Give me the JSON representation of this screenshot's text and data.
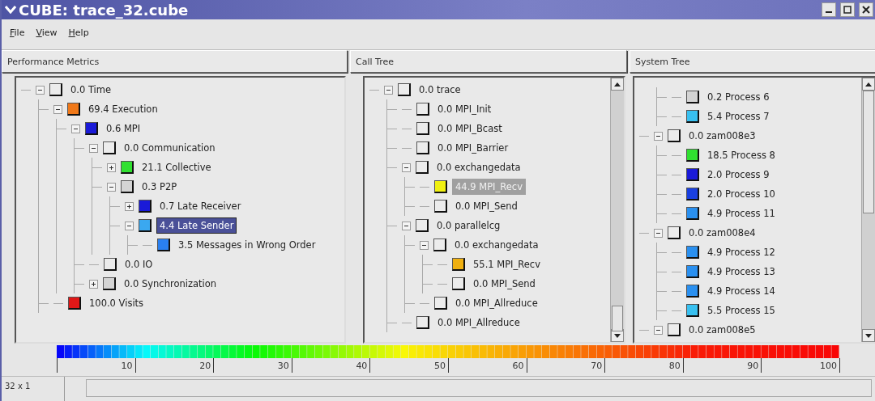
{
  "window": {
    "title": "CUBE: trace_32.cube"
  },
  "menu": [
    "File",
    "View",
    "Help"
  ],
  "metrics": {
    "title": "Performance Metrics",
    "items": [
      {
        "label": "0.0 Time",
        "color": "#ececec",
        "expanded": true,
        "selected": false,
        "children": [
          {
            "label": "69.4 Execution",
            "color": "#f07818",
            "expanded": true,
            "selected": false,
            "children": [
              {
                "label": "0.6 MPI",
                "color": "#1a1ad8",
                "expanded": true,
                "selected": false,
                "children": [
                  {
                    "label": "0.0 Communication",
                    "color": "#ececec",
                    "expanded": true,
                    "selected": false,
                    "children": [
                      {
                        "label": "21.1 Collective",
                        "color": "#30e030",
                        "expanded": false,
                        "selected": false
                      },
                      {
                        "label": "0.3 P2P",
                        "color": "#d4d4d4",
                        "expanded": true,
                        "selected": false,
                        "children": [
                          {
                            "label": "0.7 Late Receiver",
                            "color": "#1a1ad8",
                            "expanded": false,
                            "selected": false
                          },
                          {
                            "label": "4.4 Late Sender",
                            "color": "#3aa8f0",
                            "expanded": true,
                            "selected": true,
                            "children": [
                              {
                                "label": "3.5 Messages in Wrong Order",
                                "color": "#2a80f0",
                                "selected": false
                              }
                            ]
                          }
                        ]
                      }
                    ]
                  },
                  {
                    "label": "0.0 IO",
                    "color": "#ececec",
                    "selected": false
                  },
                  {
                    "label": "0.0 Synchronization",
                    "color": "#d4d4d4",
                    "expanded": false,
                    "selected": false
                  }
                ]
              }
            ]
          },
          {
            "label": "100.0 Visits",
            "color": "#e01818",
            "selected": false
          }
        ]
      }
    ]
  },
  "call_tree": {
    "title": "Call Tree",
    "items": [
      {
        "label": "0.0 trace",
        "color": "#ececec",
        "expanded": true,
        "selected": false,
        "children": [
          {
            "label": "0.0 MPI_Init",
            "color": "#ececec",
            "selected": false
          },
          {
            "label": "0.0 MPI_Bcast",
            "color": "#ececec",
            "selected": false
          },
          {
            "label": "0.0 MPI_Barrier",
            "color": "#ececec",
            "selected": false
          },
          {
            "label": "0.0 exchangedata",
            "color": "#ececec",
            "expanded": true,
            "selected": false,
            "children": [
              {
                "label": "44.9 MPI_Recv",
                "color": "#f0f010",
                "selected": true
              },
              {
                "label": "0.0 MPI_Send",
                "color": "#ececec",
                "selected": false
              }
            ]
          },
          {
            "label": "0.0 parallelcg",
            "color": "#ececec",
            "expanded": true,
            "selected": false,
            "children": [
              {
                "label": "0.0 exchangedata",
                "color": "#ececec",
                "expanded": true,
                "selected": false,
                "children": [
                  {
                    "label": "55.1 MPI_Recv",
                    "color": "#f0b010",
                    "selected": false
                  },
                  {
                    "label": "0.0 MPI_Send",
                    "color": "#ececec",
                    "selected": false
                  }
                ]
              },
              {
                "label": "0.0 MPI_Allreduce",
                "color": "#ececec",
                "selected": false
              }
            ]
          },
          {
            "label": "0.0 MPI_Allreduce",
            "color": "#ececec",
            "selected": false
          }
        ]
      }
    ]
  },
  "system_tree": {
    "title": "System Tree",
    "continued": [
      {
        "label": "0.2 Process 6",
        "color": "#d4d4d4",
        "selected": false
      },
      {
        "label": "5.4 Process 7",
        "color": "#38c0f0",
        "selected": false
      }
    ],
    "items": [
      {
        "label": "0.0 zam008e3",
        "color": "#ececec",
        "expanded": true,
        "selected": false,
        "children": [
          {
            "label": "18.5 Process 8",
            "color": "#30e030",
            "selected": false
          },
          {
            "label": "2.0 Process 9",
            "color": "#1a1ad8",
            "selected": false
          },
          {
            "label": "2.0 Process 10",
            "color": "#1a40e0",
            "selected": false
          },
          {
            "label": "4.9 Process 11",
            "color": "#2a90f0",
            "selected": false
          }
        ]
      },
      {
        "label": "0.0 zam008e4",
        "color": "#ececec",
        "expanded": true,
        "selected": false,
        "children": [
          {
            "label": "4.9 Process 12",
            "color": "#2a90f0",
            "selected": false
          },
          {
            "label": "4.9 Process 13",
            "color": "#2a90f0",
            "selected": false
          },
          {
            "label": "4.9 Process 14",
            "color": "#2a90f0",
            "selected": false
          },
          {
            "label": "5.5 Process 15",
            "color": "#38c0f0",
            "selected": false
          }
        ]
      },
      {
        "label": "0.0 zam008e5",
        "color": "#ececec",
        "expanded": true,
        "selected": false
      }
    ]
  },
  "scale": {
    "ticks": [
      "10",
      "20",
      "30",
      "40",
      "50",
      "60",
      "70",
      "80",
      "90",
      "100"
    ]
  },
  "status_bar": {
    "text": "32 x 1"
  }
}
